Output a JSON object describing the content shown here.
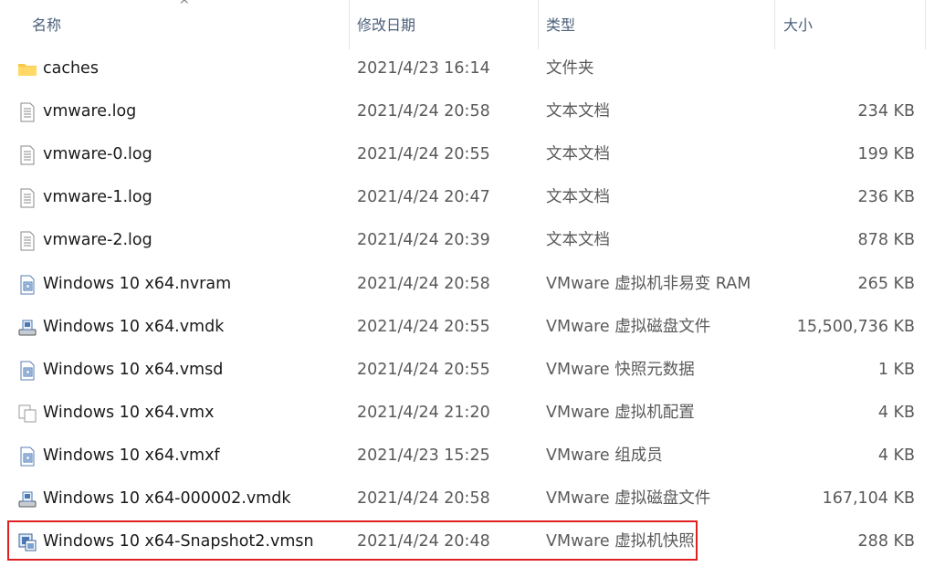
{
  "header": {
    "name": "名称",
    "date": "修改日期",
    "type": "类型",
    "size": "大小",
    "sort_indicator": "^"
  },
  "files": [
    {
      "name": "caches",
      "date": "2021/4/23 16:14",
      "type": "文件夹",
      "size": "",
      "icon": "folder-icon"
    },
    {
      "name": "vmware.log",
      "date": "2021/4/24 20:58",
      "type": "文本文档",
      "size": "234 KB",
      "icon": "text-document-icon"
    },
    {
      "name": "vmware-0.log",
      "date": "2021/4/24 20:55",
      "type": "文本文档",
      "size": "199 KB",
      "icon": "text-document-icon"
    },
    {
      "name": "vmware-1.log",
      "date": "2021/4/24 20:47",
      "type": "文本文档",
      "size": "236 KB",
      "icon": "text-document-icon"
    },
    {
      "name": "vmware-2.log",
      "date": "2021/4/24 20:39",
      "type": "文本文档",
      "size": "878 KB",
      "icon": "text-document-icon"
    },
    {
      "name": "Windows 10 x64.nvram",
      "date": "2021/4/24 20:58",
      "type": "VMware 虚拟机非易变 RAM",
      "size": "265 KB",
      "icon": "vmware-file-icon"
    },
    {
      "name": "Windows 10 x64.vmdk",
      "date": "2021/4/24 20:55",
      "type": "VMware 虚拟磁盘文件",
      "size": "15,500,736 KB",
      "icon": "virtual-disk-icon"
    },
    {
      "name": "Windows 10 x64.vmsd",
      "date": "2021/4/24 20:55",
      "type": "VMware 快照元数据",
      "size": "1 KB",
      "icon": "vmware-file-icon"
    },
    {
      "name": "Windows 10 x64.vmx",
      "date": "2021/4/24 21:20",
      "type": "VMware 虚拟机配置",
      "size": "4 KB",
      "icon": "vm-config-icon"
    },
    {
      "name": "Windows 10 x64.vmxf",
      "date": "2021/4/23 15:25",
      "type": "VMware 组成员",
      "size": "4 KB",
      "icon": "vmware-file-icon"
    },
    {
      "name": "Windows 10 x64-000002.vmdk",
      "date": "2021/4/24 20:58",
      "type": "VMware 虚拟磁盘文件",
      "size": "167,104 KB",
      "icon": "virtual-disk-icon"
    },
    {
      "name": "Windows 10 x64-Snapshot2.vmsn",
      "date": "2021/4/24 20:48",
      "type": "VMware 虚拟机快照",
      "size": "288 KB",
      "icon": "snapshot-icon"
    }
  ],
  "colors": {
    "folder": "#f8c74a",
    "highlight_border": "#e02020",
    "header_text": "#4c607a"
  }
}
